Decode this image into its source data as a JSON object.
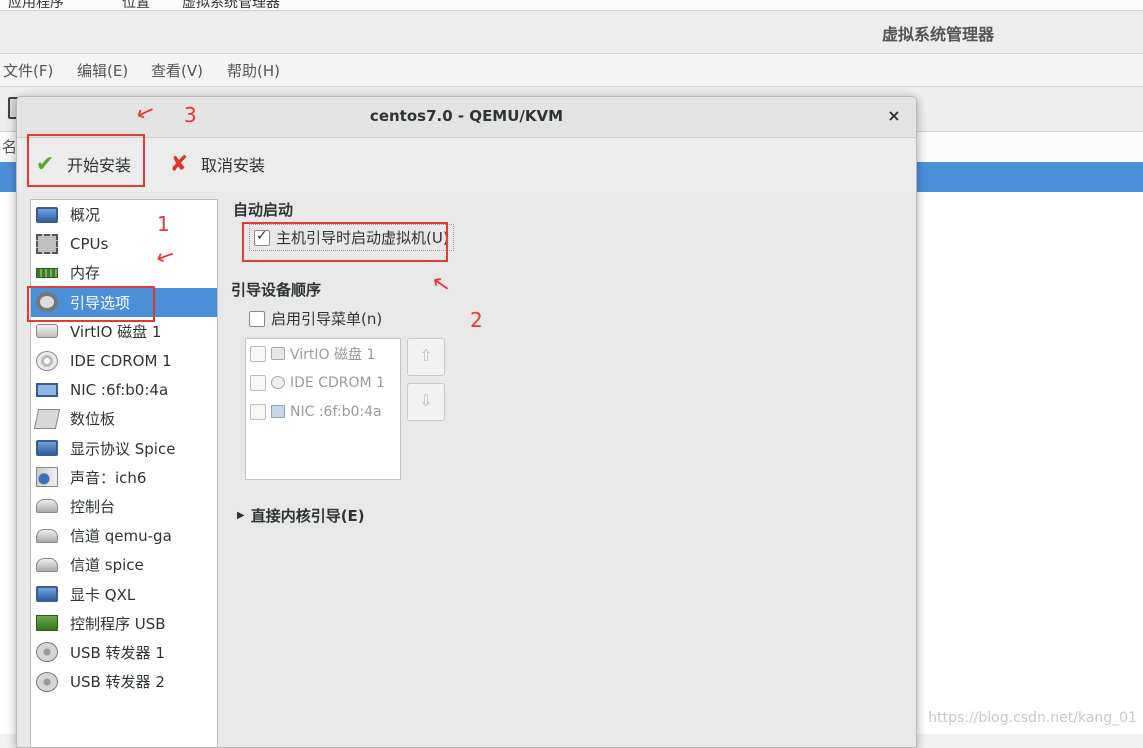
{
  "background": {
    "topbar": {
      "items": [
        "应用程序",
        "位置",
        "虚拟系统管理器"
      ]
    },
    "window_title": "虚拟系统管理器",
    "menu": [
      "文件(F)",
      "编辑(E)",
      "查看(V)",
      "帮助(H)"
    ],
    "list_header": "名",
    "watermark": "https://blog.csdn.net/kang_01"
  },
  "dialog": {
    "title": "centos7.0 - QEMU/KVM",
    "close": "×",
    "toolbar": {
      "start_install": "开始安装",
      "cancel_install": "取消安装",
      "start_icon": "check-icon",
      "cancel_icon": "cross-icon"
    },
    "sidebar": {
      "selected_index": 3,
      "items": [
        {
          "label": "概况",
          "icon": "monitor-icon"
        },
        {
          "label": "CPUs",
          "icon": "cpu-icon"
        },
        {
          "label": "内存",
          "icon": "memory-icon"
        },
        {
          "label": "引导选项",
          "icon": "gear-icon"
        },
        {
          "label": "VirtIO 磁盘 1",
          "icon": "disk-icon"
        },
        {
          "label": "IDE CDROM 1",
          "icon": "cdrom-icon"
        },
        {
          "label": "NIC :6f:b0:4a",
          "icon": "nic-icon"
        },
        {
          "label": "数位板",
          "icon": "tablet-icon"
        },
        {
          "label": "显示协议 Spice",
          "icon": "display-icon"
        },
        {
          "label": "声音：ich6",
          "icon": "sound-icon"
        },
        {
          "label": "控制台",
          "icon": "console-icon"
        },
        {
          "label": "信道 qemu-ga",
          "icon": "channel-icon"
        },
        {
          "label": "信道 spice",
          "icon": "channel-icon"
        },
        {
          "label": "显卡 QXL",
          "icon": "video-card-icon"
        },
        {
          "label": "控制程序 USB",
          "icon": "controller-icon"
        },
        {
          "label": "USB 转发器 1",
          "icon": "usb-icon"
        },
        {
          "label": "USB 转发器 2",
          "icon": "usb-icon"
        }
      ]
    },
    "autostart": {
      "heading": "自动启动",
      "checkbox_label": "主机引导时启动虚拟机(U)",
      "checked": true
    },
    "boot_order": {
      "heading": "引导设备顺序",
      "enable_menu_label": "启用引导菜单(n)",
      "enable_menu_checked": false,
      "devices": [
        {
          "label": "VirtIO 磁盘 1",
          "checked": false,
          "icon": "disk-icon"
        },
        {
          "label": "IDE CDROM 1",
          "checked": false,
          "icon": "cdrom-icon"
        },
        {
          "label": "NIC :6f:b0:4a",
          "checked": false,
          "icon": "nic-icon"
        }
      ],
      "move_up": "⇧",
      "move_down": "⇩"
    },
    "direct_kernel": {
      "label": "直接内核引导(E)",
      "expanded": false
    }
  },
  "annotations": {
    "numbers": [
      "1",
      "2",
      "3"
    ],
    "color": "#e53935"
  },
  "colors": {
    "selection": "#4a90d9",
    "annotation": "#e53935"
  }
}
